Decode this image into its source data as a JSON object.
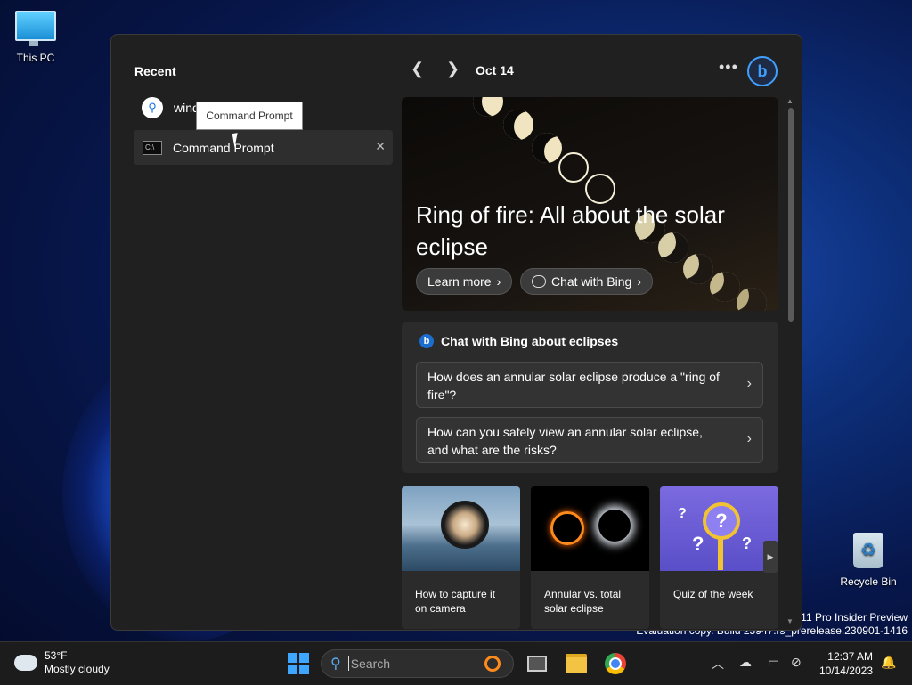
{
  "desktop": {
    "this_pc_label": "This PC",
    "recycle_bin_label": "Recycle Bin"
  },
  "panel": {
    "recent_title": "Recent",
    "search_text": "wind",
    "tooltip": "Command Prompt",
    "recent_items": [
      {
        "label": "Command Prompt"
      }
    ],
    "date": "Oct 14",
    "hero": {
      "title": "Ring of fire: All about the solar eclipse",
      "learn_more": "Learn more",
      "chat_with_bing": "Chat with Bing"
    },
    "chat": {
      "title": "Chat with Bing about eclipses",
      "questions": [
        "How does an annular solar eclipse produce a \"ring of fire\"?",
        "How can you safely view an annular solar eclipse, and what are the risks?"
      ]
    },
    "tiles": [
      {
        "caption": "How to capture it on camera"
      },
      {
        "caption": "Annular vs. total solar eclipse"
      },
      {
        "caption": "Quiz of the week"
      }
    ]
  },
  "watermark": {
    "line1": "s 11 Pro Insider Preview",
    "line2": "Evaluation copy. Build 25947.rs_prerelease.230901-1416"
  },
  "taskbar": {
    "weather_temp": "53°F",
    "weather_desc": "Mostly cloudy",
    "search_placeholder": "Search",
    "time": "12:37 AM",
    "date": "10/14/2023"
  },
  "colors": {
    "accent": "#3fa6ff",
    "panel_bg": "#202020"
  }
}
